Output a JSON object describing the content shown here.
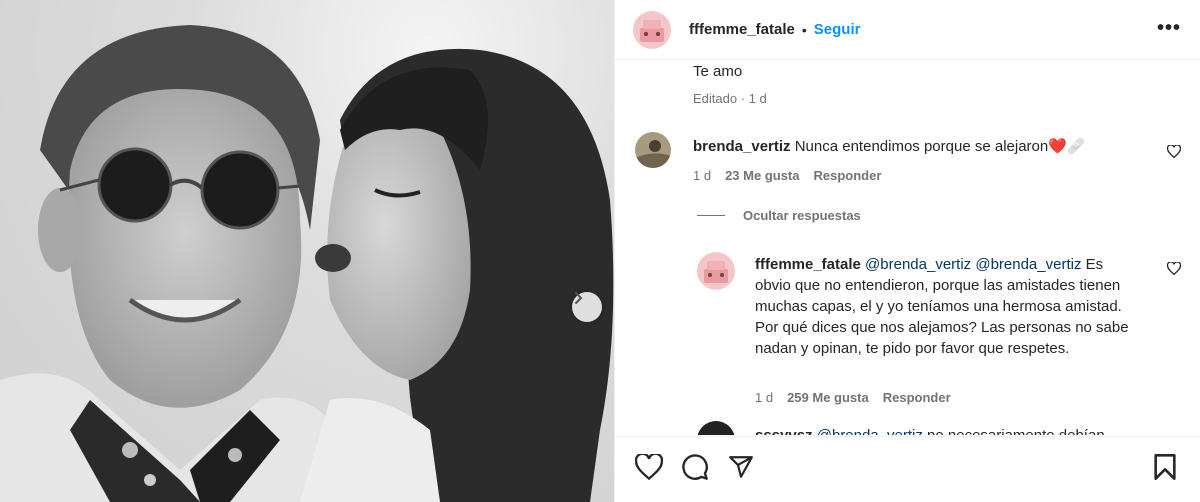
{
  "post": {
    "username": "fffemme_fatale",
    "dot": "•",
    "follow_label": "Seguir",
    "more_label": "•••"
  },
  "comments": {
    "prev_text": "Te amo",
    "prev_meta": "Editado · 1 d",
    "c1": {
      "username": "brenda_vertiz",
      "text": "Nunca entendimos porque se alejaron",
      "emoji": "❤️🩹",
      "time": "1 d",
      "likes": "23 Me gusta",
      "reply": "Responder"
    },
    "hide_replies": "Ocultar respuestas",
    "r1": {
      "username": "fffemme_fatale",
      "mention1": "@brenda_vertiz",
      "mention2": "@brenda_vertiz",
      "text": "Es obvio que no entendieron, porque las amistades tienen muchas capas, el y yo teníamos una hermosa amistad. Por qué dices que nos alejamos? Las personas no sabe nadan y opinan, te pido por favor que respetes.",
      "time": "1 d",
      "likes": "259 Me gusta",
      "reply": "Responder"
    },
    "r2": {
      "username": "sssyvsz",
      "mention": "@brenda_vertiz",
      "text": "no necesariamente debían"
    }
  },
  "icons": [
    "heart-icon",
    "comment-icon",
    "share-icon",
    "save-icon",
    "chevron-right-icon",
    "more-icon"
  ],
  "colors": {
    "accent": "#0095f6",
    "mention": "#00376b",
    "muted": "#737373",
    "heart_red": "#e0245e"
  }
}
